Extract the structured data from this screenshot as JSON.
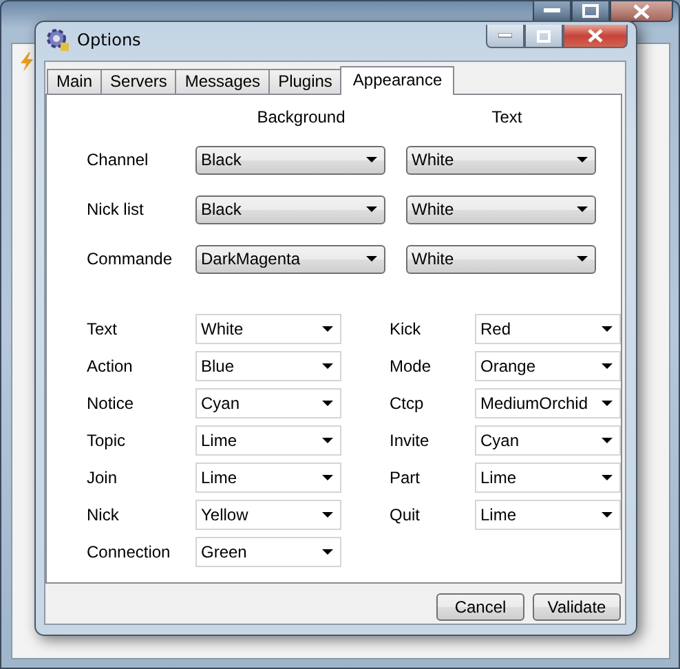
{
  "window": {
    "title": "Options"
  },
  "tabs": [
    {
      "label": "Main",
      "selected": false
    },
    {
      "label": "Servers",
      "selected": false
    },
    {
      "label": "Messages",
      "selected": false
    },
    {
      "label": "Plugins",
      "selected": false
    },
    {
      "label": "Appearance",
      "selected": true
    }
  ],
  "column_headers": [
    "Background",
    "Text"
  ],
  "style_rows": [
    {
      "label": "Channel",
      "background": "Black",
      "text": "White"
    },
    {
      "label": "Nick list",
      "background": "Black",
      "text": "White"
    },
    {
      "label": "Commande",
      "background": "DarkMagenta",
      "text": "White"
    }
  ],
  "colors_left": [
    {
      "label": "Text",
      "value": "White"
    },
    {
      "label": "Action",
      "value": "Blue"
    },
    {
      "label": "Notice",
      "value": "Cyan"
    },
    {
      "label": "Topic",
      "value": "Lime"
    },
    {
      "label": "Join",
      "value": "Lime"
    },
    {
      "label": "Nick",
      "value": "Yellow"
    },
    {
      "label": "Connection",
      "value": "Green"
    }
  ],
  "colors_right": [
    {
      "label": "Kick",
      "value": "Red"
    },
    {
      "label": "Mode",
      "value": "Orange"
    },
    {
      "label": "Ctcp",
      "value": "MediumOrchid"
    },
    {
      "label": "Invite",
      "value": "Cyan"
    },
    {
      "label": "Part",
      "value": "Lime"
    },
    {
      "label": "Quit",
      "value": "Lime"
    }
  ],
  "buttons": [
    "Cancel",
    "Validate"
  ]
}
